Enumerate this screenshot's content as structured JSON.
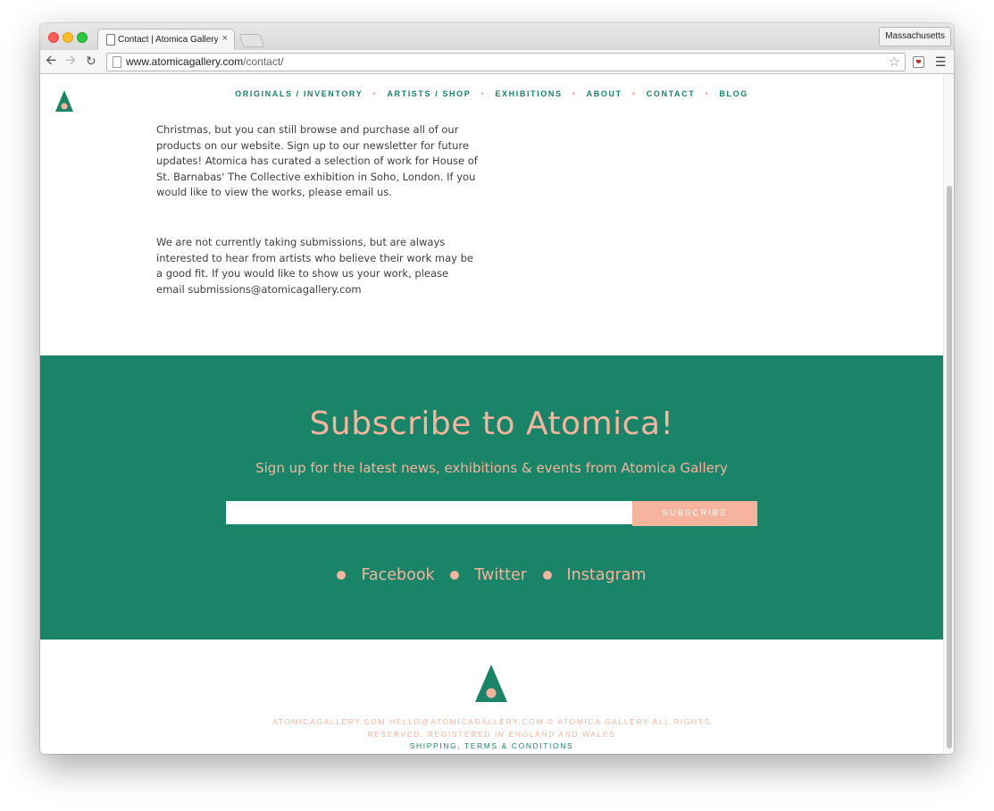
{
  "browser": {
    "tab_title": "Contact | Atomica Gallery",
    "tab_close": "×",
    "profile": "Massachusetts",
    "url_domain": "www.atomicagallery.com",
    "url_path": "/contact/",
    "icons": [
      "page-icon",
      "back-arrow-icon",
      "forward-arrow-icon",
      "reload-icon",
      "star-icon",
      "extension-icon",
      "hamburger-menu-icon"
    ]
  },
  "nav": {
    "items": [
      "ORIGINALS / INVENTORY",
      "ARTISTS / SHOP",
      "EXHIBITIONS",
      "ABOUT",
      "CONTACT",
      "BLOG"
    ],
    "separator": "•"
  },
  "content": {
    "para1": "Christmas, but you can still browse and purchase all of our products on our website. Sign up to our newsletter for future updates! Atomica has curated a selection of work for House of St. Barnabas' The Collective exhibition in Soho, London. If you would like to view the works, please email us.",
    "para2": "We are not currently taking submissions, but are always interested to hear from artists who believe their work may be a good fit. If you would like to show us your work, please email submissions@atomicagallery.com"
  },
  "subscribe": {
    "title": "Subscribe to Atomica!",
    "description": "Sign up for the latest news, exhibitions & events from Atomica Gallery",
    "email_value": "",
    "button": "SUBSCRIBE",
    "social": [
      "Facebook",
      "Twitter",
      "Instagram"
    ]
  },
  "footer": {
    "line1": "ATOMICAGALLERY.COM HELLO@ATOMICAGALLERY.COM © ATOMICA GALLERY ALL RIGHTS",
    "line2": "RESERVED. REGISTERED IN ENGLAND AND WALES",
    "line3": "SHIPPING, TERMS & CONDITIONS"
  },
  "colors": {
    "brand_green": "#1a8469",
    "brand_peach": "#f6b39d"
  }
}
